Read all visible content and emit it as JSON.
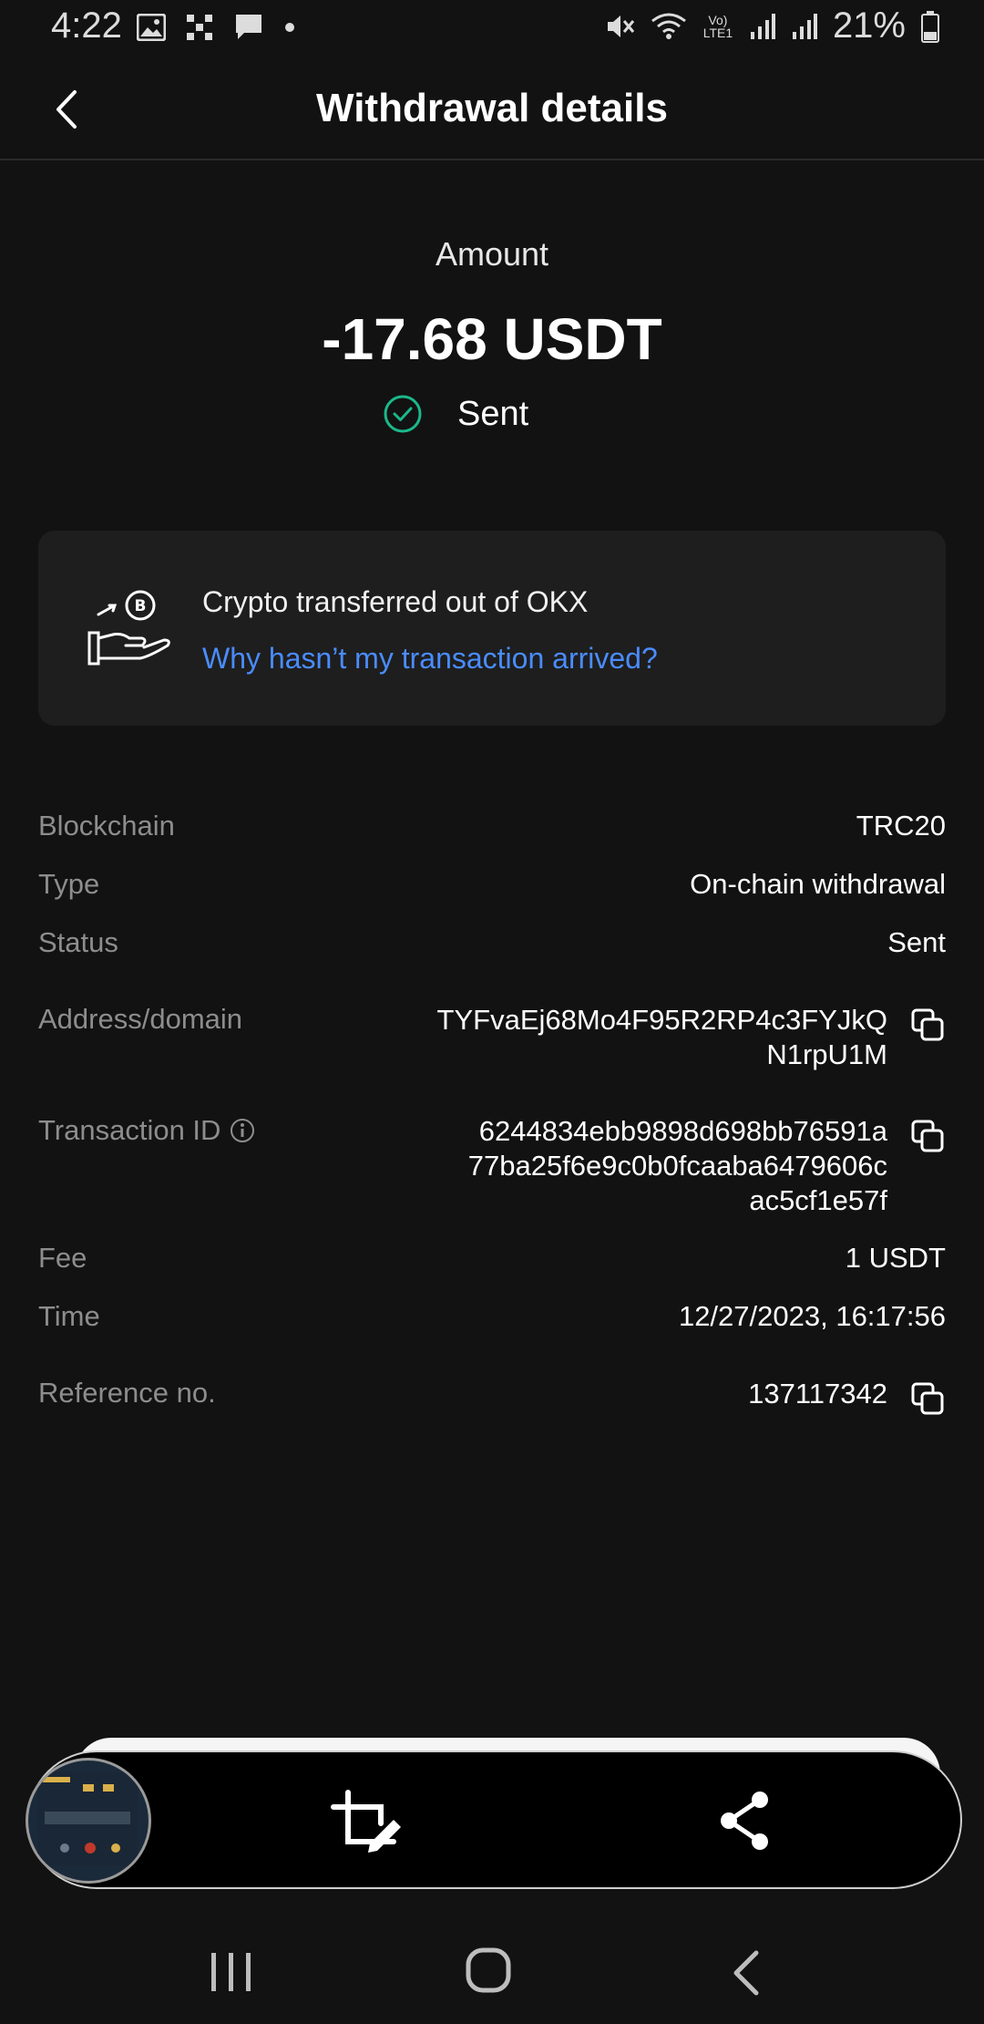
{
  "status_bar": {
    "time": "4:22",
    "battery": "21%",
    "network_label": "Vo) LTE1"
  },
  "header": {
    "title": "Withdrawal details"
  },
  "amount": {
    "label": "Amount",
    "value": "-17.68 USDT",
    "status": "Sent",
    "status_color": "#1bb88a"
  },
  "info_card": {
    "title": "Crypto transferred out of OKX",
    "link": "Why hasn’t my transaction arrived?",
    "link_color": "#4a8cff"
  },
  "details": {
    "blockchain": {
      "label": "Blockchain",
      "value": "TRC20"
    },
    "type": {
      "label": "Type",
      "value": "On-chain withdrawal"
    },
    "status": {
      "label": "Status",
      "value": "Sent"
    },
    "address": {
      "label": "Address/domain",
      "line1": "TYFvaEj68Mo4F95R2RP4c3FYJkQ",
      "line2": "N1rpU1M"
    },
    "txid": {
      "label": "Transaction ID",
      "line1": "6244834ebb9898d698bb76591a",
      "line2": "77ba25f6e9c0b0fcaaba6479606c",
      "line3": "ac5cf1e57f"
    },
    "fee": {
      "label": "Fee",
      "value": "1 USDT"
    },
    "time": {
      "label": "Time",
      "value": "12/27/2023, 16:17:56"
    },
    "reference": {
      "label": "Reference no.",
      "value": "137117342"
    }
  },
  "icons": {
    "back": "chevron-left-icon",
    "status": "check-circle-icon",
    "card": "hand-coin-icon",
    "copy": "copy-icon",
    "info": "info-icon",
    "crop": "crop-edit-icon",
    "share": "share-icon"
  }
}
